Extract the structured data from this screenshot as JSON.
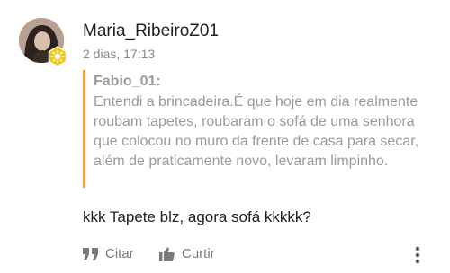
{
  "post": {
    "username": "Maria_RibeiroZ01",
    "timestamp": "2 dias, 17:13",
    "quote": {
      "author": "Fabio_01:",
      "text": "Entendi a brincadeira.É que hoje em dia realmente roubam tapetes, roubaram o sofá de uma senhora que colocou no muro da frente de casa para secar, além de praticamente novo, levaram limpinho."
    },
    "reply": "kkk Tapete blz, agora sofá kkkkk?",
    "actions": {
      "cite_label": "Citar",
      "like_label": "Curtir"
    }
  },
  "colors": {
    "quote_bar": "#f5a033",
    "badge": "#f5c518",
    "muted_text": "#9a9a9a"
  },
  "icons": {
    "avatar_badge": "sun-badge-icon",
    "cite": "quote-icon",
    "like": "thumbs-up-icon",
    "more": "more-vertical-icon"
  }
}
